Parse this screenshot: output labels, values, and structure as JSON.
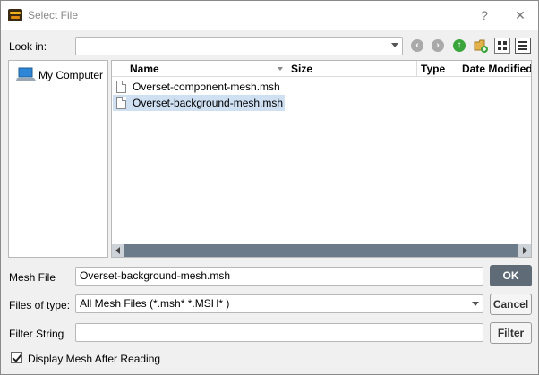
{
  "window": {
    "title": "Select File",
    "help_glyph": "?",
    "close_glyph": "✕"
  },
  "look_in": {
    "label": "Look in:",
    "value": ""
  },
  "nav_icons": [
    "back-icon",
    "forward-icon",
    "up-folder-icon",
    "new-folder-icon",
    "list-view-icon",
    "detail-view-icon"
  ],
  "sidebar": {
    "items": [
      {
        "label": "My Computer",
        "icon": "computer-icon"
      }
    ]
  },
  "file_list": {
    "columns": [
      "Name",
      "Size",
      "Type",
      "Date Modified"
    ],
    "files": [
      {
        "name": "Overset-component-mesh.msh",
        "selected": false
      },
      {
        "name": "Overset-background-mesh.msh",
        "selected": true
      }
    ]
  },
  "form": {
    "mesh_file_label": "Mesh File",
    "mesh_file_value": "Overset-background-mesh.msh",
    "files_of_type_label": "Files of type:",
    "files_of_type_value": "All Mesh Files (*.msh* *.MSH* )",
    "filter_string_label": "Filter String",
    "filter_string_value": ""
  },
  "buttons": {
    "ok": "OK",
    "cancel": "Cancel",
    "filter": "Filter"
  },
  "options": {
    "display_mesh_label": "Display Mesh After Reading",
    "display_mesh_checked": true
  },
  "colors": {
    "selection": "#cfe0f3",
    "ok_button": "#5f6b77",
    "scrollbar": "#6b7b89"
  }
}
